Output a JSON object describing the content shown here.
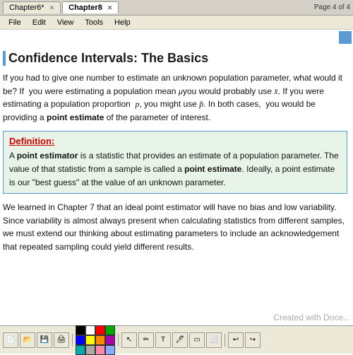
{
  "titlebar": {
    "tabs": [
      {
        "label": "Chapter6*",
        "active": false
      },
      {
        "label": "Chapter8",
        "active": true
      }
    ]
  },
  "menu": {
    "items": [
      "File",
      "Edit",
      "View",
      "Tools",
      "Help"
    ]
  },
  "page_indicator": "Page 4 of 4",
  "title": "Confidence Intervals: The Basics",
  "intro": {
    "text": "If you had to give one number to estimate an unknown population parameter, what would it be? If  you were estimating a population mean μyou would probably use x̄. If you were estimating a population proportion  p, you might use p̂. In both cases,  you would be providing a point estimate of the parameter of interest."
  },
  "definition": {
    "label": "Definition:",
    "text": "A point estimator is a statistic that provides an estimate of a population parameter. The value of that statistic from a sample is called a point estimate. Ideally, a point estimate is our \"best guess\" at the value of an unknown parameter."
  },
  "body": {
    "text": "We learned in Chapter 7 that an ideal point estimator will have no bias and low variability.  Since variability is almost always present when calculating statistics from different samples, we must extend our thinking about estimating parameters to include an acknowledgement that repeated sampling could yield different results."
  },
  "watermark": "Created with Doce...",
  "colors": {
    "blue_accent": "#5b9bd5",
    "green_bg": "#e8f4e8",
    "red_label": "#cc0000",
    "toolbar_bg": "#ece9d8"
  },
  "toolbar": {
    "swatches": [
      "#000000",
      "#ffffff",
      "#ff0000",
      "#00aa00",
      "#0000ff",
      "#ffff00",
      "#ff8800",
      "#aa00aa",
      "#00aaaa",
      "#aaaaaa",
      "#ff88aa",
      "#88aaff"
    ]
  }
}
